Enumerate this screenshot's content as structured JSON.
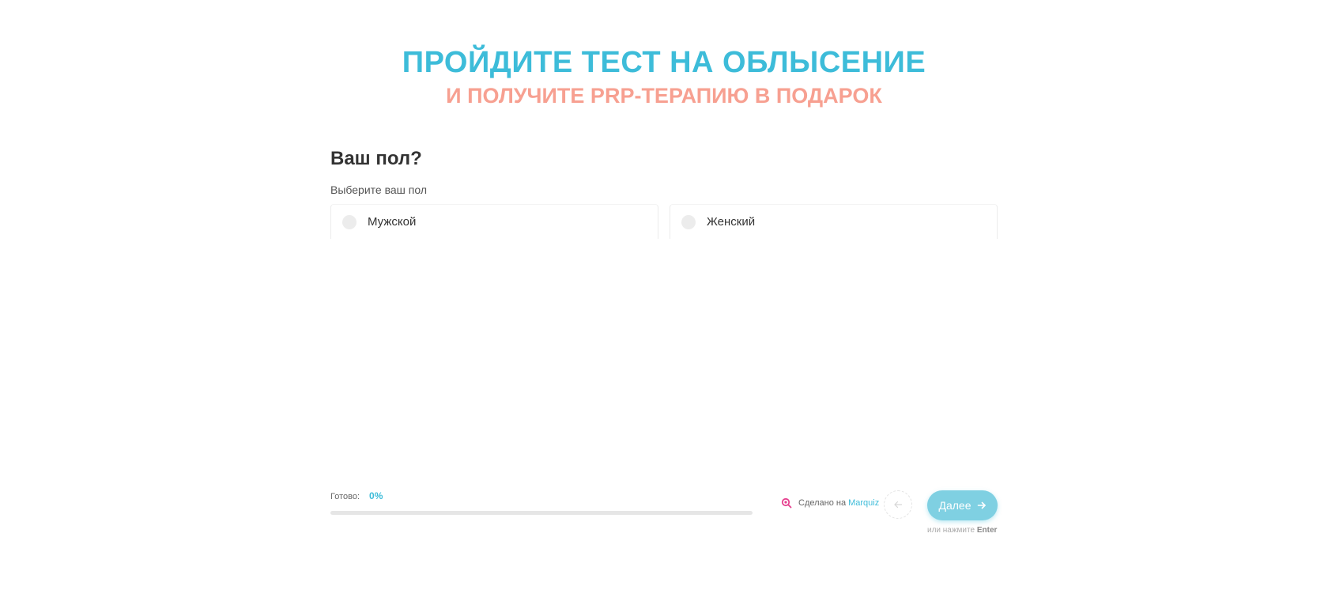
{
  "header": {
    "title": "ПРОЙДИТЕ ТЕСТ НА ОБЛЫСЕНИЕ",
    "subtitle": "И ПОЛУЧИТЕ PRP-ТЕРАПИЮ В ПОДАРОК"
  },
  "question": {
    "title": "Ваш пол?",
    "hint": "Выберите ваш пол",
    "options": [
      {
        "label": "Мужской",
        "selected": false
      },
      {
        "label": "Женский",
        "selected": false
      }
    ]
  },
  "footer": {
    "progress_label": "Готово:",
    "progress_value": "0%",
    "progress_fraction": 0,
    "made_with": "Сделано на",
    "brand": "Marquiz",
    "next_label": "Далее",
    "enter_hint_prefix": "или нажмите",
    "enter_hint_key": "Enter"
  },
  "colors": {
    "title": "#3dbcd9",
    "subtitle": "#f7a091",
    "accent": "#3dbcd9",
    "next_button": "#7fd0e2",
    "brand_logo": "#e6408f"
  },
  "icons": {
    "logo": "marquiz-logo-icon",
    "back": "arrow-left-icon",
    "next": "arrow-right-icon"
  }
}
